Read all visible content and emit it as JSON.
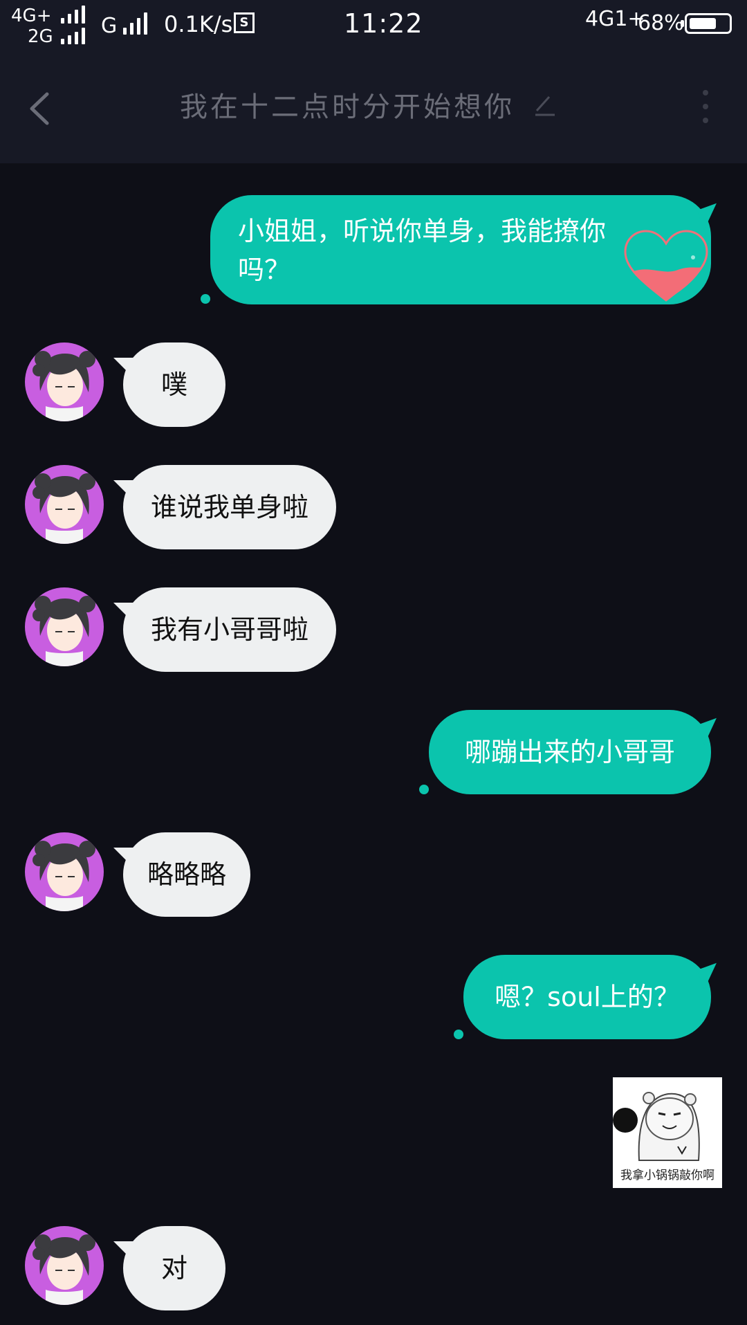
{
  "status_bar": {
    "net_top": "4G+",
    "net_bottom": "2G",
    "net_g": "G",
    "speed": "0.1K/s",
    "s_icon": "S",
    "time": "11:22",
    "net_right": "4G1+",
    "battery": "68%",
    "battery_level": 0.68
  },
  "header": {
    "title": "我在十二点时分开始想你",
    "back_icon": "chevron-left-icon",
    "edit_icon": "pencil-icon",
    "more_icon": "more-vertical-icon"
  },
  "messages": [
    {
      "side": "out",
      "text_line1": "小姐姐，听说你单身，我能撩你",
      "text_line2": "吗？"
    },
    {
      "side": "in",
      "text": "噗"
    },
    {
      "side": "in",
      "text": "谁说我单身啦"
    },
    {
      "side": "in",
      "text": "我有小哥哥啦"
    },
    {
      "side": "out",
      "text": "哪蹦出来的小哥哥"
    },
    {
      "side": "in",
      "text": "略略略"
    },
    {
      "side": "out",
      "text": "嗯？soul上的？"
    },
    {
      "side": "out",
      "type": "sticker",
      "caption": "我拿小锅锅敲你啊"
    },
    {
      "side": "in",
      "text": "对"
    }
  ],
  "colors": {
    "background": "#0e0f17",
    "bar": "#171925",
    "outgoing": "#0bc4ad",
    "incoming": "#eef0f1",
    "avatar_bg": "#c85ee0"
  }
}
